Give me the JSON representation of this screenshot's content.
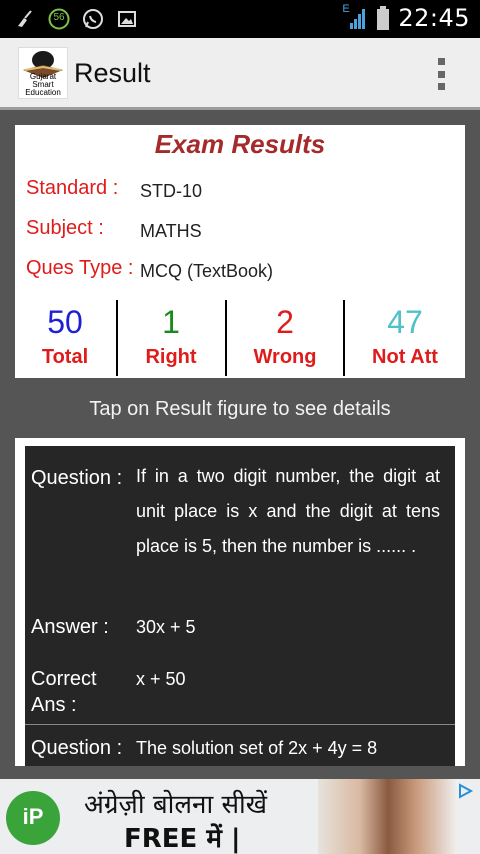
{
  "status_bar": {
    "time": "22:45",
    "notification_badge": "56",
    "network_type": "E",
    "icons": [
      "broom-icon",
      "notification-count-icon",
      "whatsapp-icon",
      "image-icon",
      "signal-icon",
      "battery-icon"
    ]
  },
  "action_bar": {
    "title": "Result",
    "logo_text": "Gujarat Smart Education"
  },
  "results": {
    "heading": "Exam Results",
    "standard_label": "Standard :",
    "standard_value": "STD-10",
    "subject_label": "Subject :",
    "subject_value": "MATHS",
    "ques_type_label": "Ques Type :",
    "ques_type_value": "MCQ (TextBook)",
    "stats": [
      {
        "value": "50",
        "label": "Total",
        "color": "#1f1fd6"
      },
      {
        "value": "1",
        "label": "Right",
        "color": "#1a8a1a"
      },
      {
        "value": "2",
        "label": "Wrong",
        "color": "#e01b1b"
      },
      {
        "value": "47",
        "label": "Not Att",
        "color": "#4fc1c9"
      }
    ]
  },
  "hint": "Tap on Result figure to see details",
  "questions": [
    {
      "question_label": "Question :",
      "question": "If in a two digit number, the digit at unit place is x and the digit at tens place is 5, then the number is ...... .",
      "answer_label": "Answer :",
      "answer": "30x + 5",
      "correct_label": "Correct Ans :",
      "correct": "x + 50"
    },
    {
      "question_label": "Question :",
      "question": "The solution set of 2x + 4y = 8"
    }
  ],
  "ad": {
    "line1": "अंग्रेज़ी बोलना सीखें",
    "line2": "FREE में |",
    "logo_text": "iP"
  },
  "colors": {
    "accent_red": "#e01b1b",
    "title_brown": "#a52a2a",
    "background": "#555555"
  }
}
